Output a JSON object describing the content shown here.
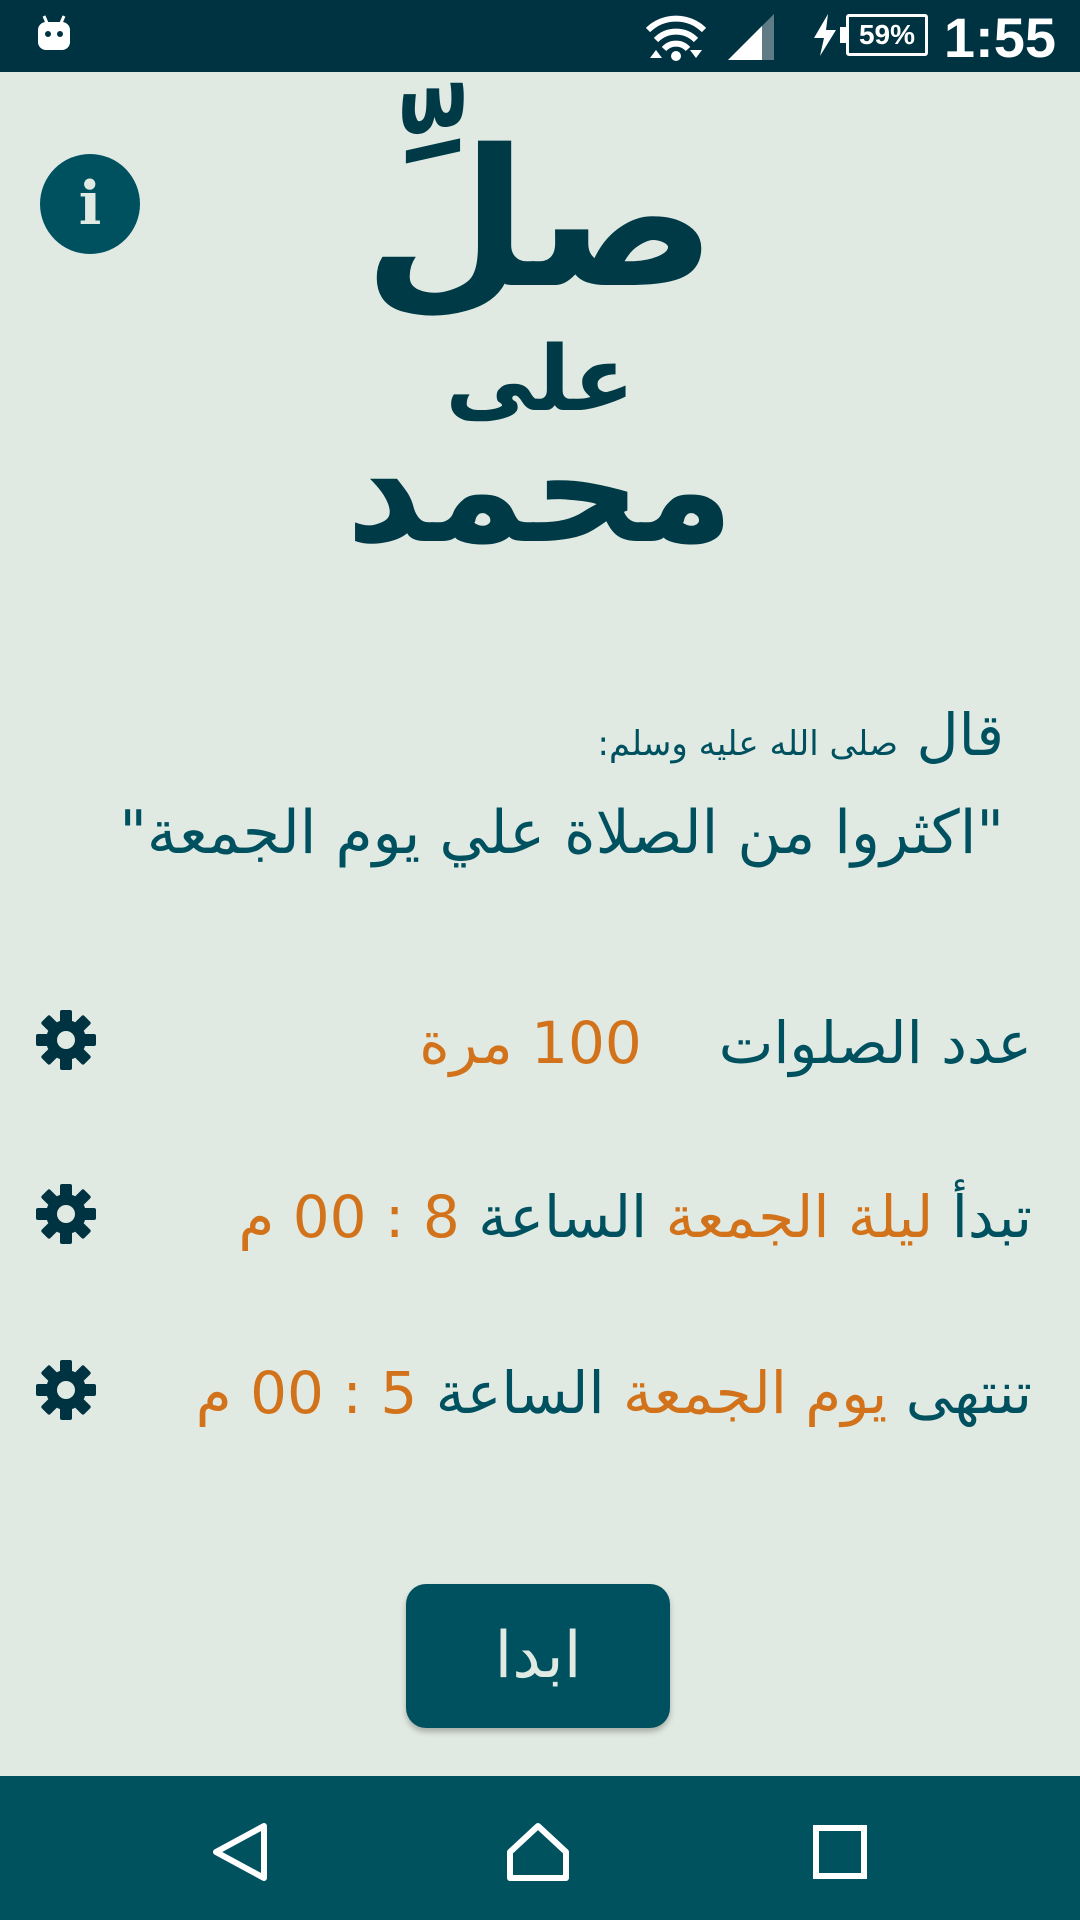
{
  "status_bar": {
    "time": "1:55",
    "battery": "59%",
    "icons": [
      "android-icon",
      "wifi-icon",
      "signal-icon",
      "charging-icon",
      "battery-icon"
    ]
  },
  "info_button": {
    "label": "i",
    "icon": "info-icon"
  },
  "logo": {
    "line1": "صلِّ",
    "line2": "على",
    "line3": "محمد"
  },
  "hadith": {
    "said": "قال",
    "honorific": "صلى الله عليه وسلم:",
    "quote": "\"اكثروا من الصلاة علي يوم الجمعة\""
  },
  "settings": {
    "count": {
      "label": "عدد الصلوات",
      "value": "100 مرة",
      "icon": "gear-icon"
    },
    "start": {
      "prefix": "تبدأ",
      "day": "ليلة الجمعة",
      "mid": "الساعة",
      "time": "8 : 00 م",
      "icon": "gear-icon"
    },
    "end": {
      "prefix": "تنتهى",
      "day": "يوم الجمعة",
      "mid": "الساعة",
      "time": "5 : 00 م",
      "icon": "gear-icon"
    }
  },
  "start_button": {
    "label": "ابدا"
  },
  "nav_bar": {
    "icons": [
      "back-icon",
      "home-icon",
      "recent-apps-icon"
    ]
  },
  "colors": {
    "background": "#e0eae2",
    "primary": "#005160",
    "dark": "#003342",
    "accent": "#d2721a"
  }
}
